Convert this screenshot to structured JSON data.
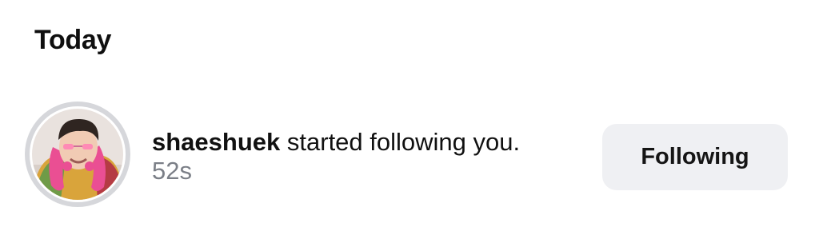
{
  "section": {
    "title": "Today"
  },
  "notification": {
    "username": "shaeshuek",
    "action_text": "started following you.",
    "timestamp": "52s",
    "avatar_icon": "user-avatar-photo",
    "button_label": "Following"
  },
  "colors": {
    "background": "#ffffff",
    "button_background": "#eff0f3",
    "timestamp_text": "#7b7f87",
    "avatar_ring": "#d6d7db"
  }
}
